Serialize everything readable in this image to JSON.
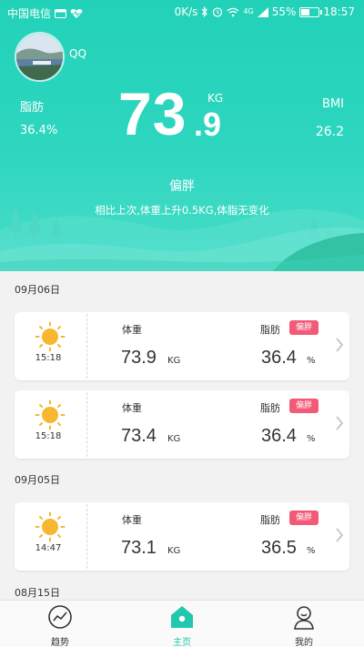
{
  "status_bar": {
    "carrier": "中国电信",
    "speed": "0K/s",
    "signal_text": "4G",
    "battery_percent": "55%",
    "battery_level": 0.55,
    "time": "18:57",
    "icons": [
      "wallet-icon",
      "heart-rate-icon",
      "bluetooth-icon",
      "alarm-icon",
      "wifi-icon",
      "signal-icon",
      "battery-icon"
    ]
  },
  "profile": {
    "username": "QQ"
  },
  "summary": {
    "fat_label": "脂肪",
    "fat_value": "36.4%",
    "weight_integer": "73",
    "weight_decimal": ".9",
    "weight_unit": "KG",
    "bmi_label": "BMI",
    "bmi_value": "26.2",
    "body_status": "偏胖",
    "change_text": "相比上次,体重上升0.5KG,体脂无变化"
  },
  "records": [
    {
      "date": "09月06日",
      "items": [
        {
          "time": "15:18",
          "weight_label": "体重",
          "weight": "73.9",
          "weight_unit": "KG",
          "fat_label": "脂肪",
          "badge": "偏胖",
          "fat": "36.4",
          "fat_unit": "%"
        },
        {
          "time": "15:18",
          "weight_label": "体重",
          "weight": "73.4",
          "weight_unit": "KG",
          "fat_label": "脂肪",
          "badge": "偏胖",
          "fat": "36.4",
          "fat_unit": "%"
        }
      ]
    },
    {
      "date": "09月05日",
      "items": [
        {
          "time": "14:47",
          "weight_label": "体重",
          "weight": "73.1",
          "weight_unit": "KG",
          "fat_label": "脂肪",
          "badge": "偏胖",
          "fat": "36.5",
          "fat_unit": "%"
        }
      ]
    },
    {
      "date": "08月15日",
      "items": []
    }
  ],
  "nav": {
    "trend": "趋势",
    "home": "主页",
    "mine": "我的",
    "active": "home"
  },
  "colors": {
    "accent": "#21c7ae",
    "hero": "#2ed6bf",
    "badge": "#f25a77",
    "sun": "#f7b731"
  }
}
